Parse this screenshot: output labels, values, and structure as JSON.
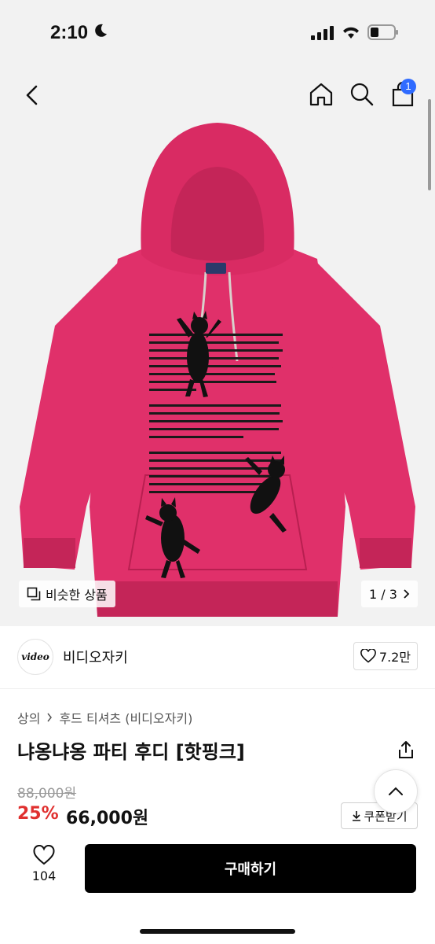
{
  "status_bar": {
    "time": "2:10"
  },
  "header": {
    "cart_count": "1"
  },
  "gallery": {
    "similar_label": "비슷한 상품",
    "page_indicator": "1 / 3",
    "print_text": "CATS ARE MYSTERIOUS AND GRACEFUL CREATURES, MOVING WITH AN ELEGANCE THAT SEEMS ALMOST EFFORTLESS. THEIR SLEEK BODIES GLIDING SILENTLY ACROSS A ROOM. WITH A FLICK OF THEIR TAIL AND A GENTLE PURR, THEY CAPTURE OUR HEARTS AND IMAGINATION. EACH CAT HAS ITS OWN UNIQUE PERSONALITY, FROM THE PLAYFUL KITTEN WHO CHASES AFTER SHADOWS TO THE WISE OLD CAT WHO WATCHES THE WORLD WITH KNOWING EYES. WHETHER THEY'RE CURLED UP IN A COZY NOOK OR EXPLORING NEW TERRITORIES, CATS BRING JOY AND COMPANIONSHIP TO OUR LIVES. THEIR SOFT FUR, GENTLE PURRING, AND AFFECTIONATE NUZZLES REMIND US OF THE SIMPLE PLEASURES IN LIFE.",
    "tag_text": "video"
  },
  "brand": {
    "logo_text": "video",
    "name": "비디오자키",
    "likes": "7.2만"
  },
  "breadcrumb": [
    "상의",
    "후드 티셔츠 (비디오자키)"
  ],
  "product": {
    "title": "냐옹냐옹 파티 후디 [핫핑크]",
    "original_price": "88,000원",
    "discount": "25%",
    "price": "66,000원",
    "coupon_label": "쿠폰받기"
  },
  "bottom_bar": {
    "like_count": "104",
    "buy_label": "구매하기"
  },
  "colors": {
    "hoodie": "#e0306a",
    "hoodie_shade": "#c42558",
    "accent": "#2f6bff",
    "discount": "#e0302f",
    "buy_button": "#000000"
  }
}
